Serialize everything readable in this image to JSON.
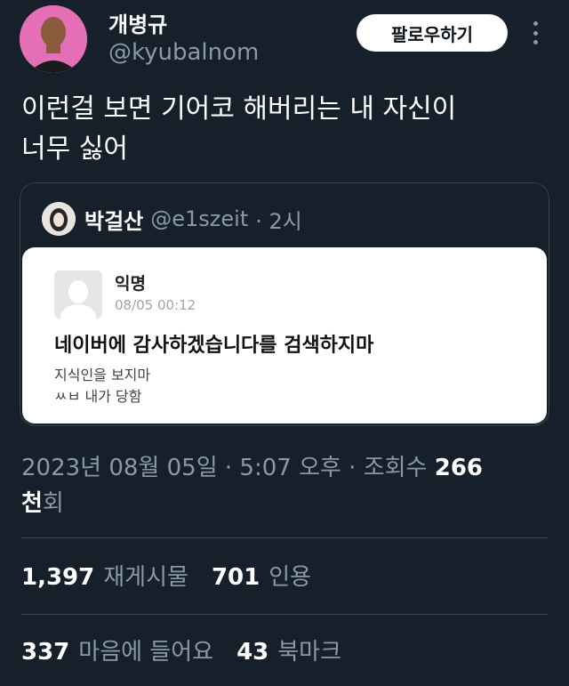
{
  "author": {
    "name": "개병규",
    "handle": "@kyubalnom",
    "follow_label": "팔로우하기"
  },
  "tweet": {
    "lines": [
      "이런걸 보면 기어코 해버리는 내 자신이",
      "너무 싫어"
    ]
  },
  "quote": {
    "name": "박걸산",
    "handle": "@e1szeit",
    "time": "· 2시",
    "image": {
      "anon_name": "익명",
      "anon_date": "08/05 00:12",
      "title": "네이버에 감사하겠습니다를 검색하지마",
      "body_lines": [
        "지식인을 보지마",
        "ㅆㅂ 내가 당함"
      ]
    }
  },
  "meta": {
    "timestamp": "2023년 08월 05일 · 5:07 오후 · 조회수",
    "views_num": "266",
    "views_unit": "천",
    "views_suffix": "회"
  },
  "stats": {
    "retweets": "1,397",
    "retweets_label": "재게시물",
    "quotes": "701",
    "quotes_label": "인용",
    "likes": "337",
    "likes_label": "마음에 들어요",
    "bookmarks": "43",
    "bookmarks_label": "북마크"
  },
  "colors": {
    "background": "#15202b",
    "secondary_text": "#8b98a5",
    "divider": "#38444d"
  }
}
